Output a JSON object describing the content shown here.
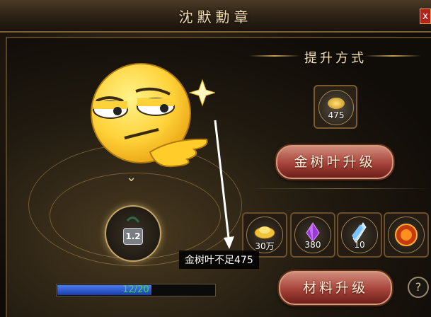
{
  "window": {
    "title": "沈默勳章",
    "close_label": "x"
  },
  "upgrade_methods": {
    "section_title": "提升方式",
    "gold_leaf_slot": {
      "icon": "gold-leaf-icon",
      "count": "475"
    },
    "gold_leaf_button": "金树叶升级",
    "materials": [
      {
        "icon": "gold-ingot-icon",
        "count": "30万"
      },
      {
        "icon": "purple-crystal-icon",
        "count": "380"
      },
      {
        "icon": "blue-crystal-icon",
        "count": "10"
      },
      {
        "icon": "fire-orb-icon",
        "count": ""
      }
    ],
    "material_button": "材料升级",
    "help_label": "?"
  },
  "medal": {
    "level": "1.2"
  },
  "progress": {
    "text": "12/20",
    "value": 0.6
  },
  "tooltip": {
    "text": "金树叶不足475"
  },
  "colors": {
    "accent_gold": "#f0dcae",
    "button_red": "#a7423a",
    "progress_blue": "#2a55d6",
    "progress_text": "#3bd84a"
  }
}
